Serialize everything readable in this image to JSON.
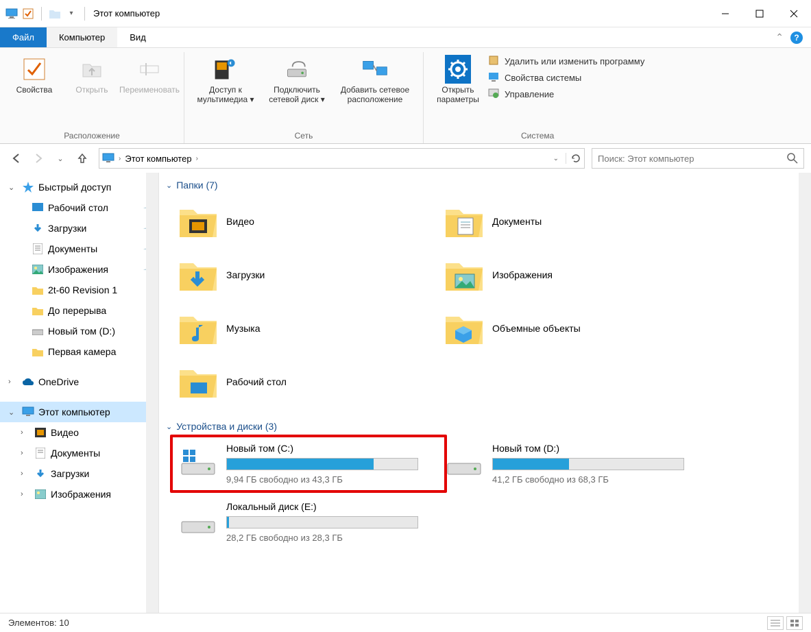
{
  "window": {
    "title": "Этот компьютер"
  },
  "tabs": {
    "file": "Файл",
    "computer": "Компьютер",
    "view": "Вид"
  },
  "ribbon": {
    "location": {
      "properties": "Свойства",
      "open": "Открыть",
      "rename": "Переименовать",
      "group_label": "Расположение"
    },
    "network": {
      "media_access": "Доступ к мультимедиа",
      "map_drive": "Подключить сетевой диск",
      "add_location": "Добавить сетевое расположение",
      "group_label": "Сеть"
    },
    "system": {
      "open_settings": "Открыть параметры",
      "uninstall": "Удалить или изменить программу",
      "sys_props": "Свойства системы",
      "manage": "Управление",
      "group_label": "Система"
    }
  },
  "address": {
    "location": "Этот компьютер"
  },
  "search": {
    "placeholder": "Поиск: Этот компьютер"
  },
  "sidebar": {
    "quick_access": "Быстрый доступ",
    "desktop": "Рабочий стол",
    "downloads": "Загрузки",
    "documents": "Документы",
    "pictures": "Изображения",
    "folder1": "2t-60 Revision 1",
    "folder2": "До перерыва",
    "drive_d": "Новый том (D:)",
    "folder3": "Первая камера",
    "onedrive": "OneDrive",
    "this_pc": "Этот компьютер",
    "videos": "Видео",
    "documents2": "Документы",
    "downloads2": "Загрузки",
    "pictures2": "Изображения"
  },
  "groups": {
    "folders": "Папки (7)",
    "drives": "Устройства и диски (3)"
  },
  "folders": {
    "videos": "Видео",
    "documents": "Документы",
    "downloads": "Загрузки",
    "pictures": "Изображения",
    "music": "Музыка",
    "objects3d": "Объемные объекты",
    "desktop": "Рабочий стол"
  },
  "drives": {
    "c": {
      "name": "Новый том (C:)",
      "status": "9,94 ГБ свободно из 43,3 ГБ",
      "fill_pct": 77
    },
    "d": {
      "name": "Новый том (D:)",
      "status": "41,2 ГБ свободно из 68,3 ГБ",
      "fill_pct": 40
    },
    "e": {
      "name": "Локальный диск (E:)",
      "status": "28,2 ГБ свободно из 28,3 ГБ",
      "fill_pct": 1
    }
  },
  "statusbar": {
    "items": "Элементов: 10"
  }
}
